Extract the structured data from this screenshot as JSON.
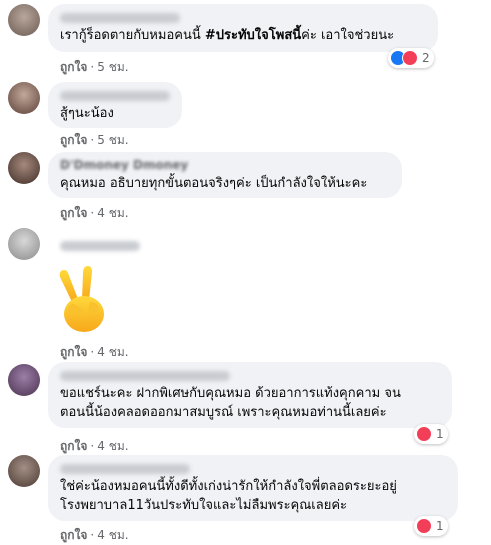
{
  "comments": [
    {
      "text_pre": "เรากู้ร็อดตายกับหมอคนนี้ ",
      "hashtag": "#ประทับใจโพสนี้",
      "text_post": "ค่ะ เอาใจช่วยนะ",
      "like_label": "ถูกใจ",
      "time": "5 ชม.",
      "reaction_count": "2"
    },
    {
      "text": "สู้ๆนะน้อง",
      "like_label": "ถูกใจ",
      "time": "5 ชม."
    },
    {
      "name": "D'Dmoney Dmoney",
      "text": "คุณหมอ อธิบายทุกขั้นตอนจริงๆค่ะ เป็นกำลังใจให้นะคะ",
      "like_label": "ถูกใจ",
      "time": "4 ชม."
    },
    {
      "sticker": "victory-hand",
      "like_label": "ถูกใจ",
      "time": "4 ชม."
    },
    {
      "text_line1": "ขอแชร์นะคะ ฝากพิเศษกับคุณหมอ ด้วยอาการแท้งคุกคาม จน",
      "text_line2": "ตอนนี้น้องคลอดออกมาสมบูรณ์ เพราะคุณหมอท่านนี้เลยค่ะ",
      "like_label": "ถูกใจ",
      "time": "4 ชม.",
      "reaction_count": "1"
    },
    {
      "text_line1": "ใช่ค่ะน้องหมอคนนี้ทั้งดีทั้งเก่งน่ารักให้กำลังใจพี่ตลอดระยะอยู่",
      "text_line2": "โรงพยาบาล11วันประทับใจและไม่ลืมพระคุณเลยค่ะ",
      "like_label": "ถูกใจ",
      "time": "4 ชม.",
      "reaction_count": "1"
    }
  ],
  "separator": "·",
  "colors": {
    "bubble": "#f0f2f5",
    "meta": "#65676b",
    "like_blue": "#1877f2",
    "love_red": "#f33e58"
  }
}
